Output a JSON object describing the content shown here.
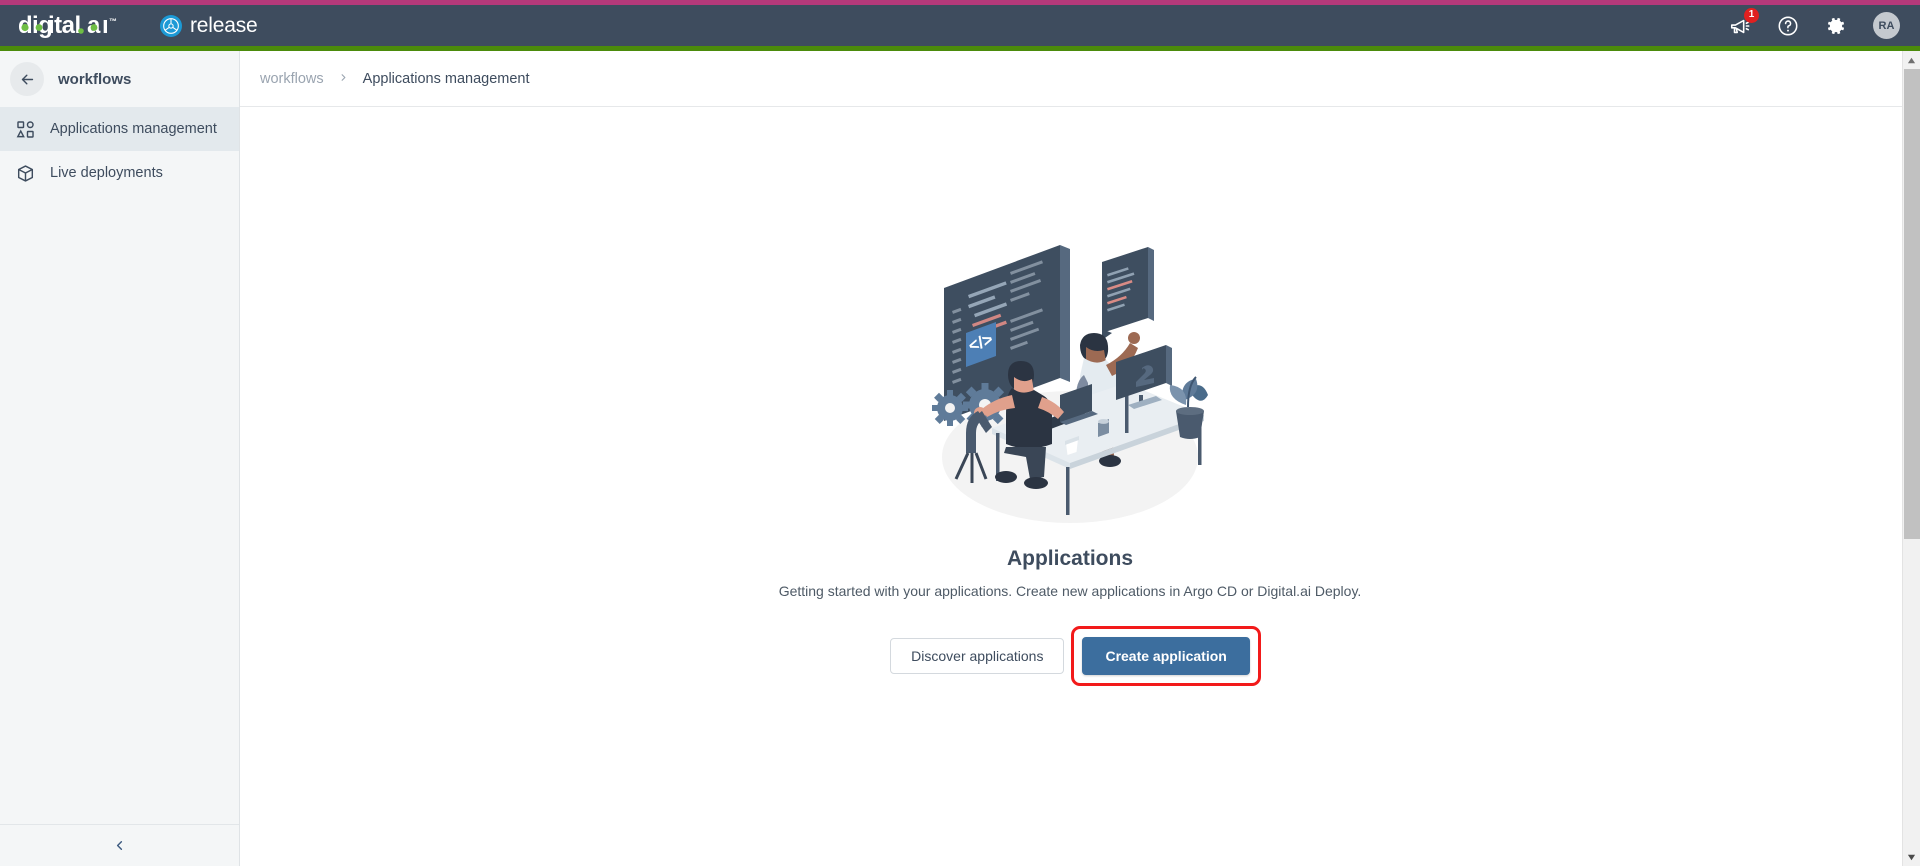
{
  "header": {
    "logo_primary": "digital.ai",
    "logo_tm": "™",
    "product_name": "release",
    "product_tm": "™",
    "icons": [
      {
        "name": "announcements-icon",
        "glyph": "megaphone",
        "badge": "1"
      },
      {
        "name": "help-icon",
        "glyph": "question-circle",
        "badge": ""
      },
      {
        "name": "settings-icon",
        "glyph": "gear",
        "badge": ""
      }
    ],
    "avatar_initials": "RA",
    "accent_top_color": "#b5397a",
    "bar_color": "#3e4c5e",
    "green_bar_color": "#4b8b0b"
  },
  "sidebar": {
    "title": "workflows",
    "back_icon": "arrow-left-icon",
    "items": [
      {
        "label": "Applications management",
        "icon": "shapes-icon",
        "active": true
      },
      {
        "label": "Live deployments",
        "icon": "package-icon",
        "active": false
      }
    ],
    "collapse_icon": "chevron-left-icon"
  },
  "breadcrumb": {
    "parent": "workflows",
    "separator": "›",
    "current": "Applications management"
  },
  "empty_state": {
    "illustration": "developers-at-desk-illustration",
    "title": "Applications",
    "subtitle": "Getting started with your applications. Create new applications in Argo CD or Digital.ai Deploy.",
    "secondary_button": "Discover applications",
    "primary_button": "Create application",
    "primary_button_color": "#3c6e9e",
    "highlight_color": "#f21a1a"
  },
  "scrollbar": {
    "up_arrow": "scroll-up-icon",
    "down_arrow": "scroll-down-icon"
  }
}
